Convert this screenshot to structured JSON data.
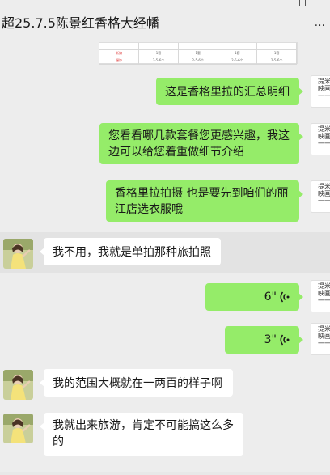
{
  "window": {
    "title": "超25.7.5陈景红香格大经幡",
    "more_label": "..."
  },
  "image_message": {
    "rows": [
      [
        "",
        "",
        "",
        "",
        ""
      ],
      [
        "新娘",
        "1套",
        "1套",
        "1套",
        "1套"
      ],
      [
        "服饰",
        "2-5-6个",
        "2-5-6个",
        "2-5-6个",
        "2-5-6个"
      ]
    ]
  },
  "messages": [
    {
      "side": "right",
      "type": "text",
      "text": "这是香格里拉的汇总明细"
    },
    {
      "side": "right",
      "type": "text",
      "text": "您看看哪几款套餐您更感兴趣，我这边可以给您着重做细节介绍"
    },
    {
      "side": "right",
      "type": "text",
      "text": "香格里拉拍摄 也是要先到咱们的丽江店选衣服哦"
    },
    {
      "side": "left",
      "type": "text",
      "text": "我不用，我就是单拍那种旅拍照"
    },
    {
      "side": "right",
      "type": "voice",
      "duration": "6\""
    },
    {
      "side": "right",
      "type": "voice",
      "duration": "3\""
    },
    {
      "side": "left",
      "type": "text",
      "text": "我的范围大概就在一两百的样子啊"
    },
    {
      "side": "left",
      "type": "text",
      "text": "我就出来旅游，肯定不可能搞这么多的"
    }
  ],
  "agent_avatar": {
    "line1": "提米",
    "line2": "映画",
    "line3": "一一"
  },
  "colors": {
    "background": "#ededed",
    "mine_bubble": "#95ec69",
    "their_bubble": "#ffffff"
  }
}
